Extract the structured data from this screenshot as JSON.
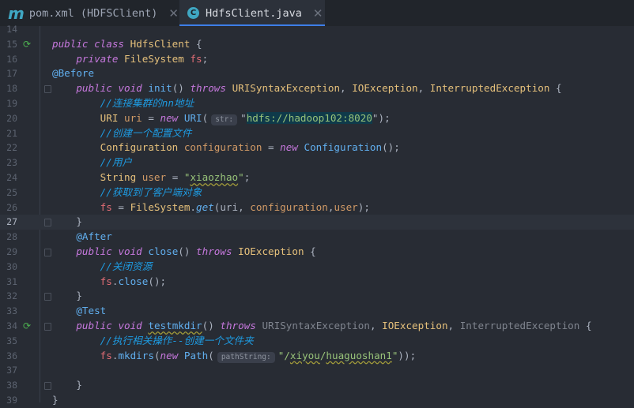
{
  "tabs": [
    {
      "label": "pom.xml (HDFSClient)",
      "icon": "maven-icon",
      "active": false
    },
    {
      "label": "HdfsClient.java",
      "icon": "java-class-icon",
      "active": true
    }
  ],
  "editor": {
    "current_line": 27,
    "lines": [
      {
        "n": "14",
        "tokens": []
      },
      {
        "n": "15",
        "run": true,
        "tokens": [
          [
            "public",
            "kw"
          ],
          [
            " "
          ],
          [
            "class",
            "kw"
          ],
          [
            " "
          ],
          [
            "HdfsClient",
            "cls"
          ],
          [
            " {"
          ]
        ]
      },
      {
        "n": "16",
        "tokens": [
          [
            "    "
          ],
          [
            "private",
            "kw"
          ],
          [
            " "
          ],
          [
            "FileSystem",
            "cls"
          ],
          [
            " "
          ],
          [
            "fs",
            "fld"
          ],
          [
            ";"
          ]
        ]
      },
      {
        "n": "17",
        "tokens": [
          [
            "@Before",
            "ann"
          ]
        ]
      },
      {
        "n": "18",
        "fold": true,
        "tokens": [
          [
            "    "
          ],
          [
            "public",
            "kw"
          ],
          [
            " "
          ],
          [
            "void",
            "kw"
          ],
          [
            " "
          ],
          [
            "init",
            "fn"
          ],
          [
            "() "
          ],
          [
            "throws",
            "kw"
          ],
          [
            " "
          ],
          [
            "URISyntaxException",
            "cls"
          ],
          [
            ", "
          ],
          [
            "IOException",
            "cls"
          ],
          [
            ", "
          ],
          [
            "InterruptedException",
            "cls"
          ],
          [
            " {"
          ]
        ]
      },
      {
        "n": "19",
        "tokens": [
          [
            "        "
          ],
          [
            "//连接集群的nn地址",
            "cm"
          ]
        ]
      },
      {
        "n": "20",
        "tokens": [
          [
            "        "
          ],
          [
            "URI",
            "cls"
          ],
          [
            " "
          ],
          [
            "uri",
            "lv"
          ],
          [
            " = "
          ],
          [
            "new",
            "kw"
          ],
          [
            " "
          ],
          [
            "URI",
            "fn"
          ],
          [
            "("
          ],
          [
            "str:",
            "hint"
          ],
          [
            "\""
          ],
          [
            "hdfs://hadoop102:8020",
            "strsel"
          ],
          [
            "\");"
          ]
        ]
      },
      {
        "n": "21",
        "tokens": [
          [
            "        "
          ],
          [
            "//创建一个配置文件",
            "cm"
          ]
        ]
      },
      {
        "n": "22",
        "tokens": [
          [
            "        "
          ],
          [
            "Configuration",
            "cls"
          ],
          [
            " "
          ],
          [
            "configuration",
            "lv"
          ],
          [
            " = "
          ],
          [
            "new",
            "kw"
          ],
          [
            " "
          ],
          [
            "Configuration",
            "fn"
          ],
          [
            "();"
          ]
        ]
      },
      {
        "n": "23",
        "tokens": [
          [
            "        "
          ],
          [
            "//用户",
            "cm"
          ]
        ]
      },
      {
        "n": "24",
        "tokens": [
          [
            "        "
          ],
          [
            "String",
            "cls"
          ],
          [
            " "
          ],
          [
            "user",
            "lv"
          ],
          [
            " = "
          ],
          [
            "\"",
            "str"
          ],
          [
            "xiaozhao",
            "str wavy"
          ],
          [
            "\"",
            "str"
          ],
          [
            ";"
          ]
        ]
      },
      {
        "n": "25",
        "tokens": [
          [
            "        "
          ],
          [
            "//获取到了客户端对象",
            "cm"
          ]
        ]
      },
      {
        "n": "26",
        "tokens": [
          [
            "        "
          ],
          [
            "fs",
            "fld"
          ],
          [
            " = "
          ],
          [
            "FileSystem",
            "cls"
          ],
          [
            "."
          ],
          [
            "get",
            "fni"
          ],
          [
            "(uri, "
          ],
          [
            "configuration",
            "lv"
          ],
          [
            ","
          ],
          [
            "user",
            "lv"
          ],
          [
            ");"
          ]
        ]
      },
      {
        "n": "27",
        "fold": true,
        "tokens": [
          [
            "    }"
          ]
        ]
      },
      {
        "n": "28",
        "tokens": [
          [
            "    "
          ],
          [
            "@After",
            "ann"
          ]
        ]
      },
      {
        "n": "29",
        "fold": true,
        "tokens": [
          [
            "    "
          ],
          [
            "public",
            "kw"
          ],
          [
            " "
          ],
          [
            "void",
            "kw"
          ],
          [
            " "
          ],
          [
            "close",
            "fn"
          ],
          [
            "() "
          ],
          [
            "throws",
            "kw"
          ],
          [
            " "
          ],
          [
            "IOException",
            "cls"
          ],
          [
            " {"
          ]
        ]
      },
      {
        "n": "30",
        "tokens": [
          [
            "        "
          ],
          [
            "//关闭资源",
            "cm"
          ]
        ]
      },
      {
        "n": "31",
        "tokens": [
          [
            "        "
          ],
          [
            "fs",
            "fld"
          ],
          [
            "."
          ],
          [
            "close",
            "fn"
          ],
          [
            "();"
          ]
        ]
      },
      {
        "n": "32",
        "fold": true,
        "tokens": [
          [
            "    }"
          ]
        ]
      },
      {
        "n": "33",
        "tokens": [
          [
            "    "
          ],
          [
            "@Test",
            "ann"
          ]
        ]
      },
      {
        "n": "34",
        "run": true,
        "fold": true,
        "tokens": [
          [
            "    "
          ],
          [
            "public",
            "kw"
          ],
          [
            " "
          ],
          [
            "void",
            "kw"
          ],
          [
            " "
          ],
          [
            "testmkdir",
            "fn wavy"
          ],
          [
            "() "
          ],
          [
            "throws",
            "kw"
          ],
          [
            " "
          ],
          [
            "URISyntaxException",
            "dim"
          ],
          [
            ", "
          ],
          [
            "IOException",
            "cls"
          ],
          [
            ", "
          ],
          [
            "InterruptedException",
            "dim"
          ],
          [
            " {"
          ]
        ]
      },
      {
        "n": "35",
        "tokens": [
          [
            "        "
          ],
          [
            "//执行相关操作--创建一个文件夹",
            "cm"
          ]
        ]
      },
      {
        "n": "36",
        "tokens": [
          [
            "        "
          ],
          [
            "fs",
            "fld"
          ],
          [
            "."
          ],
          [
            "mkdirs",
            "fn"
          ],
          [
            "("
          ],
          [
            "new",
            "kw"
          ],
          [
            " "
          ],
          [
            "Path",
            "fn"
          ],
          [
            "("
          ],
          [
            "pathString:",
            "hint"
          ],
          [
            "\"/",
            "str"
          ],
          [
            "xiyou",
            "str wavy"
          ],
          [
            "/",
            "str"
          ],
          [
            "huaguoshan1",
            "str wavy"
          ],
          [
            "\"",
            "str"
          ],
          [
            "));"
          ]
        ]
      },
      {
        "n": "37",
        "tokens": []
      },
      {
        "n": "38",
        "fold": true,
        "tokens": [
          [
            "    }"
          ]
        ]
      },
      {
        "n": "39",
        "tokens": [
          [
            "}"
          ]
        ]
      }
    ]
  }
}
